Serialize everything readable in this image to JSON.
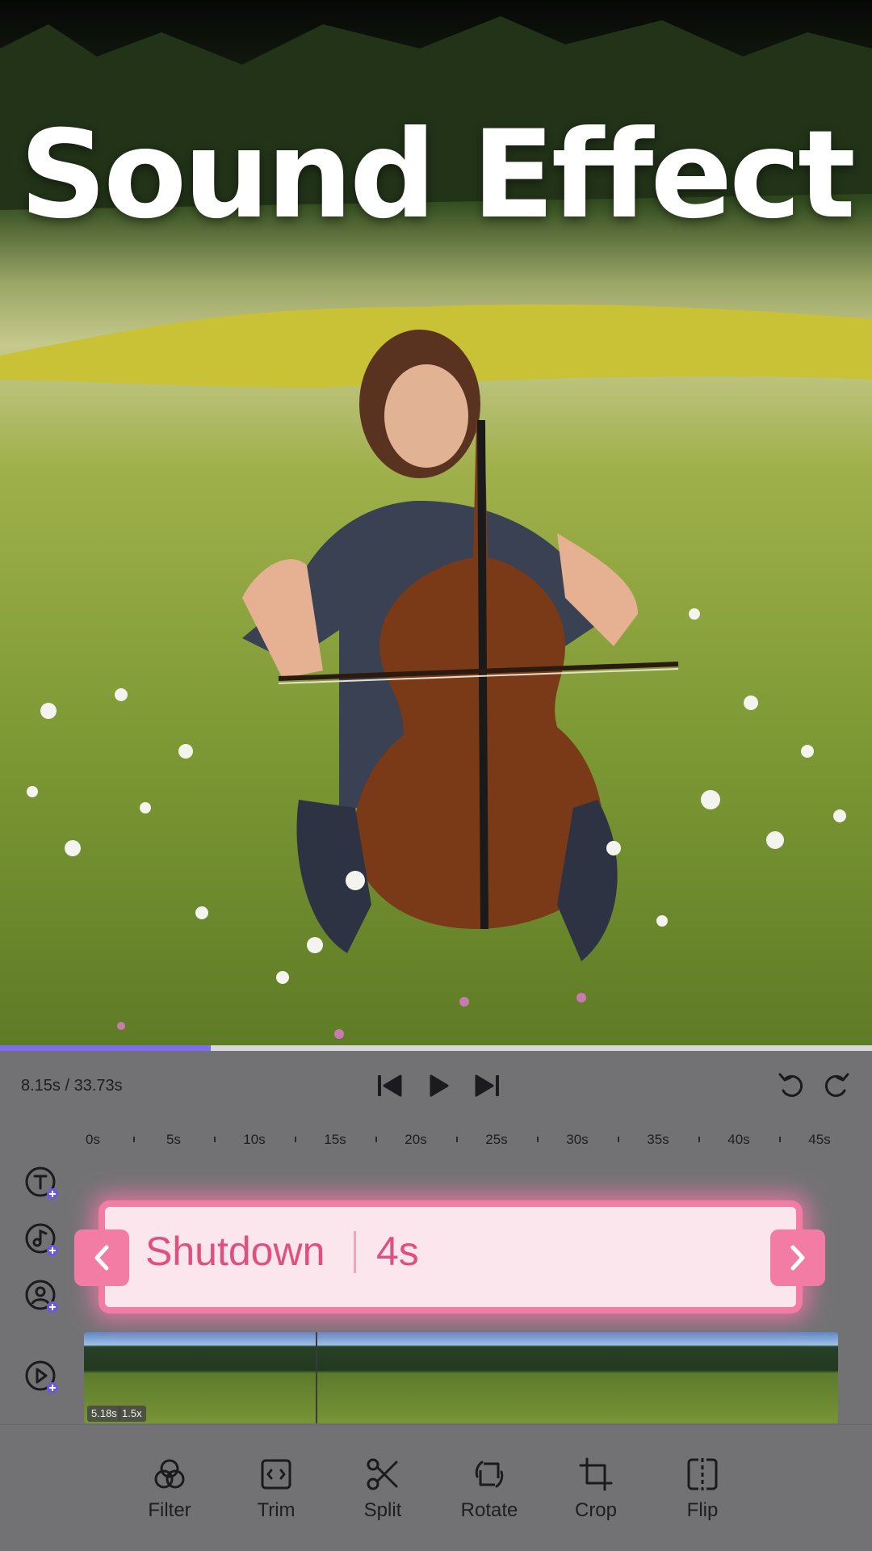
{
  "preview": {
    "overlay_text": "Sound Effect",
    "playback_progress": 0.242
  },
  "editor": {
    "time_readout": "8.15s / 33.73s",
    "ruler_labels": [
      "0s",
      "5s",
      "10s",
      "15s",
      "20s",
      "25s",
      "30s",
      "35s",
      "40s",
      "45s"
    ],
    "clip": {
      "name": "Shutdown",
      "duration": "4s"
    },
    "video_track": {
      "duration_badge": "5.18s",
      "speed_badge": "1.5x"
    }
  },
  "toolbar": {
    "filter": "Filter",
    "trim": "Trim",
    "split": "Split",
    "rotate": "Rotate",
    "crop": "Crop",
    "flip": "Flip"
  },
  "colors": {
    "accent_pink": "#f27ca4",
    "progress": "#7b6cf0",
    "panel": "#727275"
  }
}
